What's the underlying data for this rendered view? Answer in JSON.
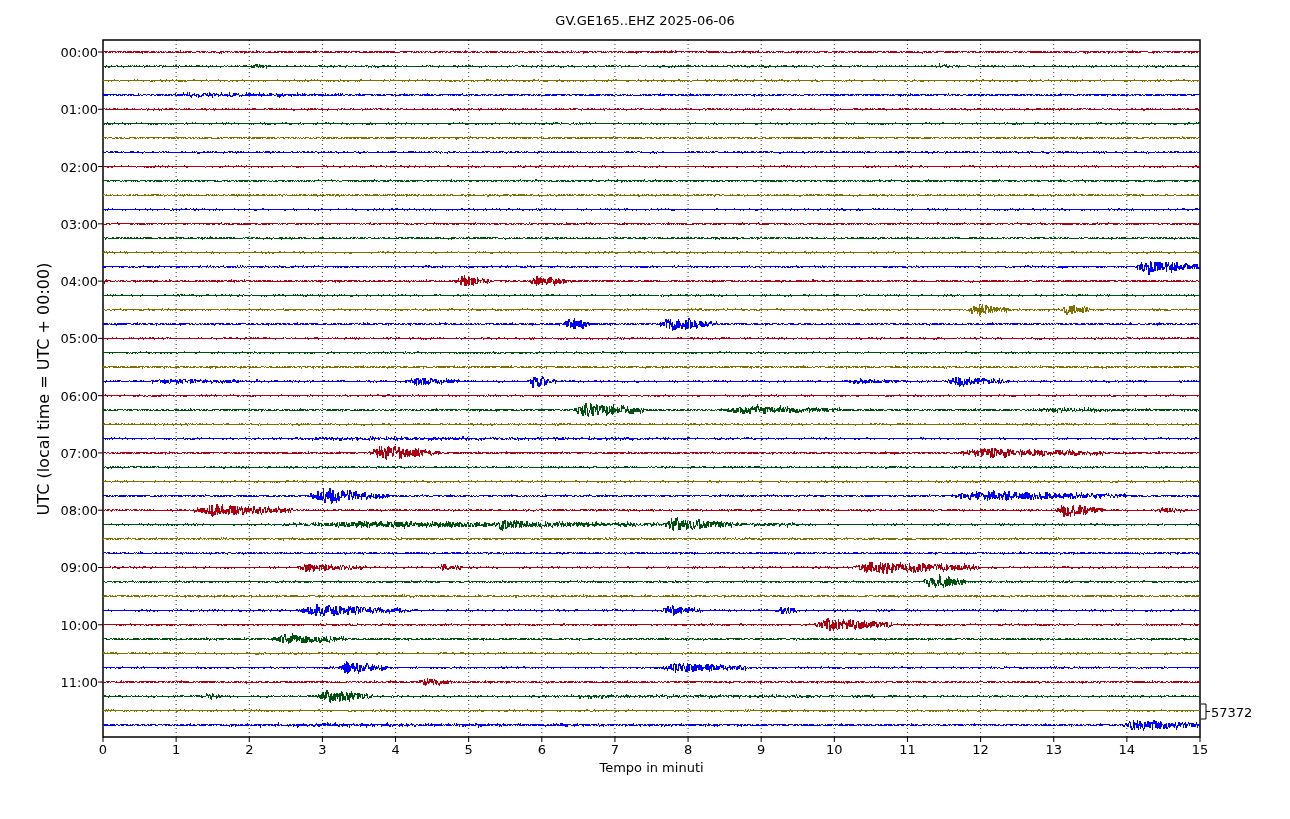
{
  "title": "GV.GE165..EHZ 2025-06-06",
  "ylabel": "UTC (local time = UTC + 00:00)",
  "xlabel": "Tempo in minuti",
  "yticks": [
    "00:00",
    "01:00",
    "02:00",
    "03:00",
    "04:00",
    "05:00",
    "06:00",
    "07:00",
    "08:00",
    "09:00",
    "10:00",
    "11:00"
  ],
  "xticks": [
    "0",
    "1",
    "2",
    "3",
    "4",
    "5",
    "6",
    "7",
    "8",
    "9",
    "10",
    "11",
    "12",
    "13",
    "14",
    "15"
  ],
  "scale_label": "57372",
  "traces": [
    {
      "color": "#b00010"
    },
    {
      "color": "#005010"
    },
    {
      "color": "#7f7000"
    },
    {
      "color": "#0000ff"
    },
    {
      "color": "#b00010"
    },
    {
      "color": "#005010"
    },
    {
      "color": "#7f7000"
    },
    {
      "color": "#0000ff"
    },
    {
      "color": "#b00010"
    },
    {
      "color": "#005010"
    },
    {
      "color": "#7f7000"
    },
    {
      "color": "#0000ff"
    },
    {
      "color": "#b00010"
    },
    {
      "color": "#005010"
    },
    {
      "color": "#7f7000"
    },
    {
      "color": "#0000ff"
    },
    {
      "color": "#b00010"
    },
    {
      "color": "#005010"
    },
    {
      "color": "#7f7000"
    },
    {
      "color": "#0000ff"
    },
    {
      "color": "#b00010"
    },
    {
      "color": "#005010"
    },
    {
      "color": "#7f7000"
    },
    {
      "color": "#0000ff"
    },
    {
      "color": "#b00010"
    },
    {
      "color": "#005010"
    },
    {
      "color": "#7f7000"
    },
    {
      "color": "#0000ff"
    },
    {
      "color": "#b00010"
    },
    {
      "color": "#005010"
    },
    {
      "color": "#7f7000"
    },
    {
      "color": "#0000ff"
    },
    {
      "color": "#b00010"
    },
    {
      "color": "#005010"
    },
    {
      "color": "#7f7000"
    },
    {
      "color": "#0000ff"
    },
    {
      "color": "#b00010"
    },
    {
      "color": "#005010"
    },
    {
      "color": "#7f7000"
    },
    {
      "color": "#0000ff"
    },
    {
      "color": "#b00010"
    },
    {
      "color": "#005010"
    },
    {
      "color": "#7f7000"
    },
    {
      "color": "#0000ff"
    },
    {
      "color": "#b00010"
    },
    {
      "color": "#005010"
    },
    {
      "color": "#7f7000"
    },
    {
      "color": "#0000ff"
    }
  ]
}
